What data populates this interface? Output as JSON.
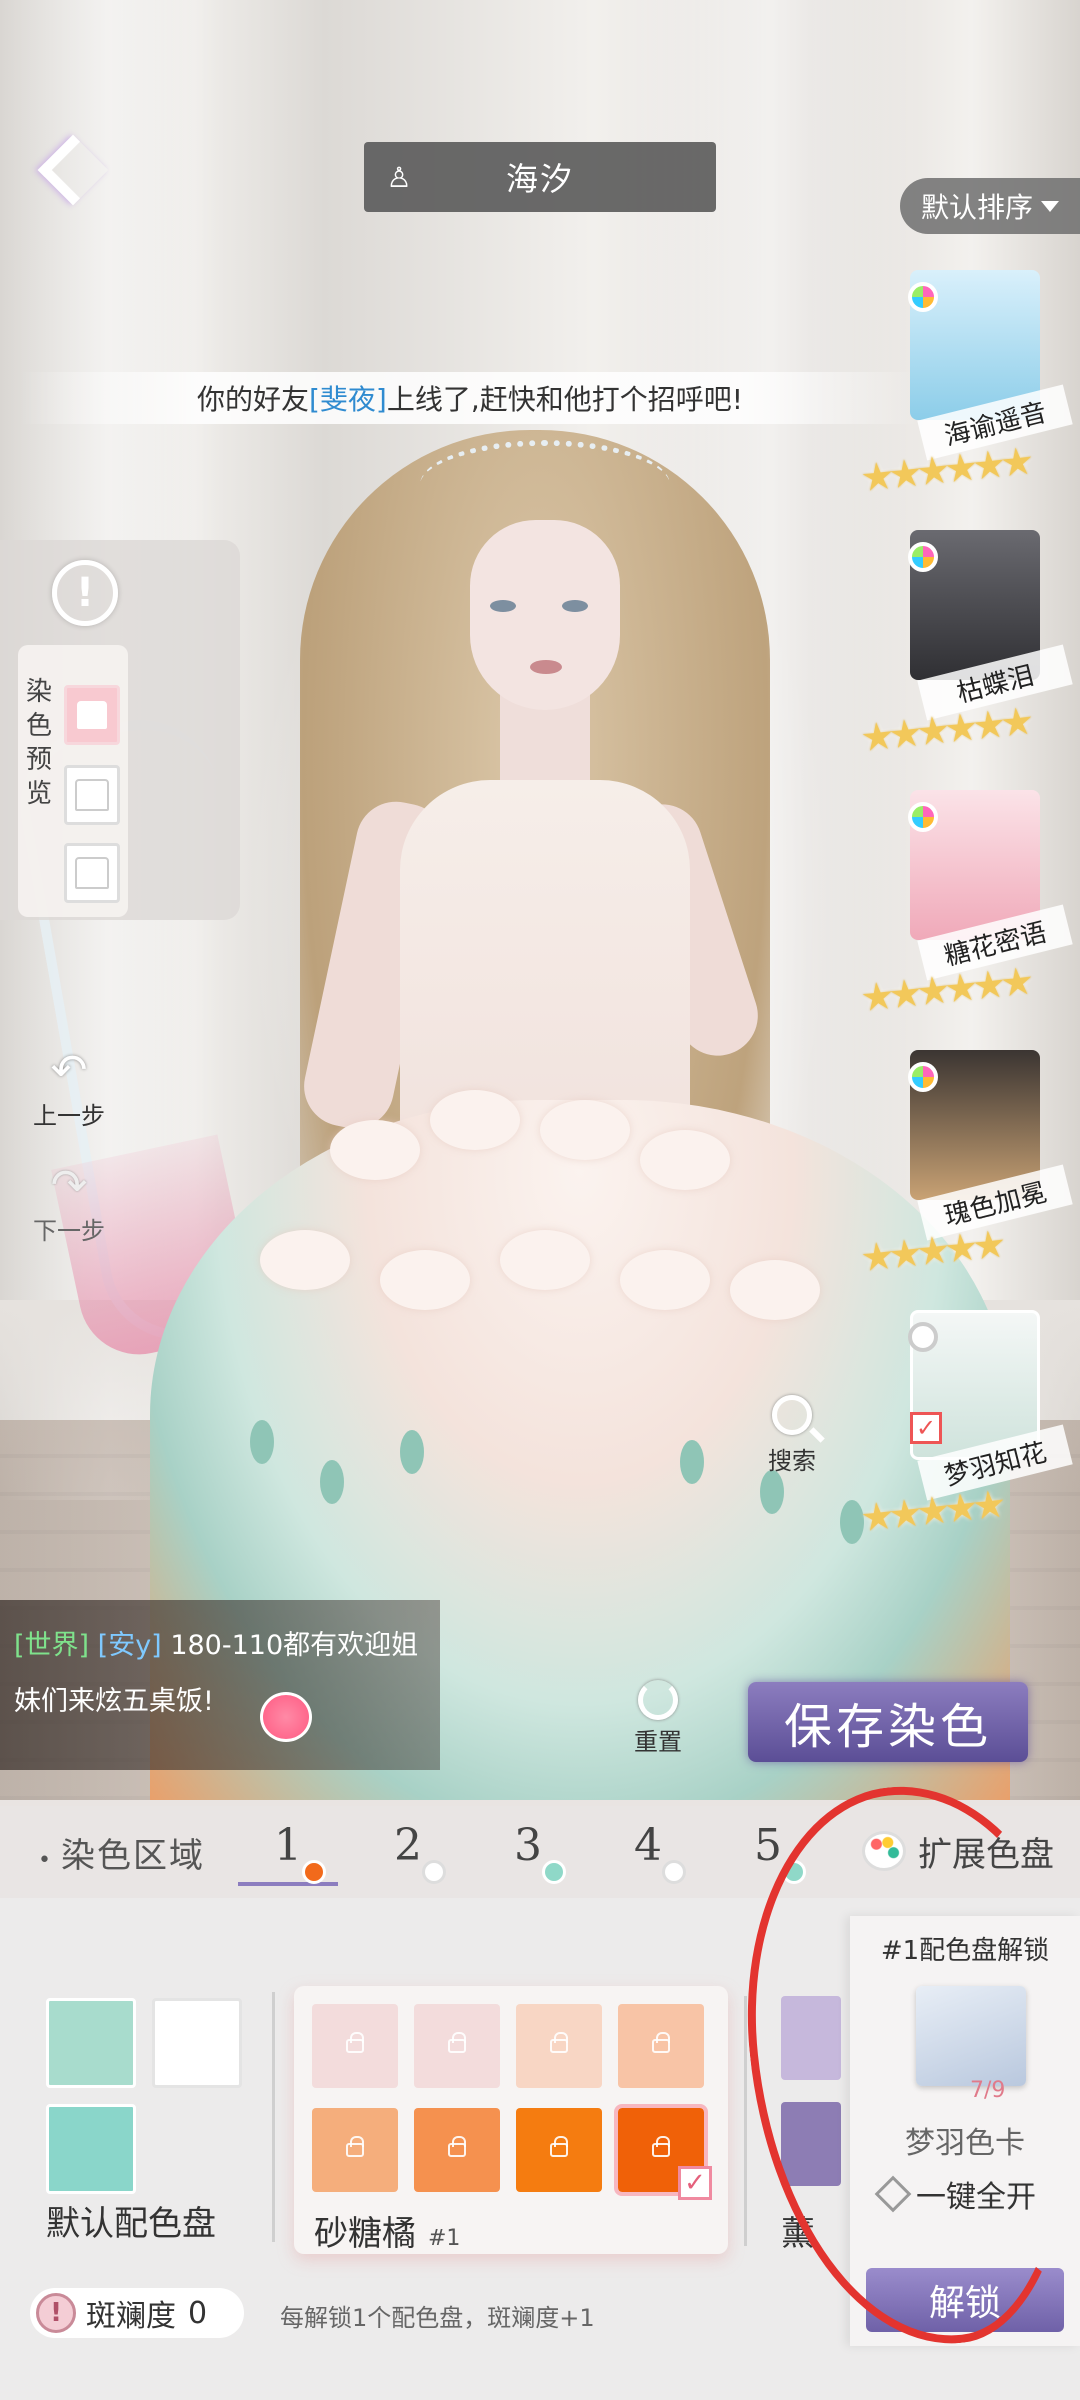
{
  "header": {
    "title": "海汐",
    "sort_label": "默认排序"
  },
  "notice": {
    "prefix": "你的好友",
    "friend": "[斐夜]",
    "suffix": "上线了,赶快和他打个招呼吧!"
  },
  "left_tools": {
    "alert_symbol": "!",
    "dye_preview_label": "染色预览",
    "undo_label": "上一步",
    "redo_label": "下一步"
  },
  "outfits": [
    {
      "name": "海谕遥音",
      "stars": "★★★★★★",
      "color": "#9fd6ee"
    },
    {
      "name": "枯蝶泪",
      "stars": "★★★★★★",
      "color": "#4a4a4e"
    },
    {
      "name": "糖花密语",
      "stars": "★★★★★★",
      "color": "#f4b8c4"
    },
    {
      "name": "瑰色加冕",
      "stars": "★★★★★",
      "color": "#c8a070"
    },
    {
      "name": "梦羽知花",
      "stars": "★★★★★",
      "color": "#e9f1ee"
    }
  ],
  "search_label": "搜索",
  "chat": {
    "channel": "[世界]",
    "user": "[安y]",
    "line1": "180-110都有欢迎姐",
    "line2": "妹们来炫五桌饭!"
  },
  "reset_label": "重置",
  "save_dye_label": "保存染色",
  "dye_tabs": {
    "label": "染色区域",
    "regions": [
      {
        "num": "1",
        "dot": "#f26a1b"
      },
      {
        "num": "2",
        "dot": "#ffffff"
      },
      {
        "num": "3",
        "dot": "#8fd8c8"
      },
      {
        "num": "4",
        "dot": "#ffffff"
      },
      {
        "num": "5",
        "dot": "#8fd8c8"
      }
    ],
    "expand_label": "扩展色盘"
  },
  "default_palette": {
    "name": "默认配色盘",
    "colors": [
      "#a8dccd",
      "#ffffff",
      "#8ad6ca"
    ]
  },
  "selected_palette": {
    "name": "砂糖橘",
    "number": "#1",
    "colors": [
      "#f3dcdc",
      "#f3dcdc",
      "#f8d6c4",
      "#f8c4a6",
      "#f5ae7c",
      "#f5914f",
      "#f57c10",
      "#f06108"
    ]
  },
  "peek_palette_char": "薰",
  "unlock": {
    "title": "#1配色盘解锁",
    "card_count": "7/9",
    "card_name": "梦羽色卡",
    "one_click": "一键全开",
    "button": "解锁"
  },
  "footer": {
    "spot_label": "斑斓度",
    "spot_value": "0",
    "hint": "每解锁1个配色盘，斑斓度+1"
  }
}
